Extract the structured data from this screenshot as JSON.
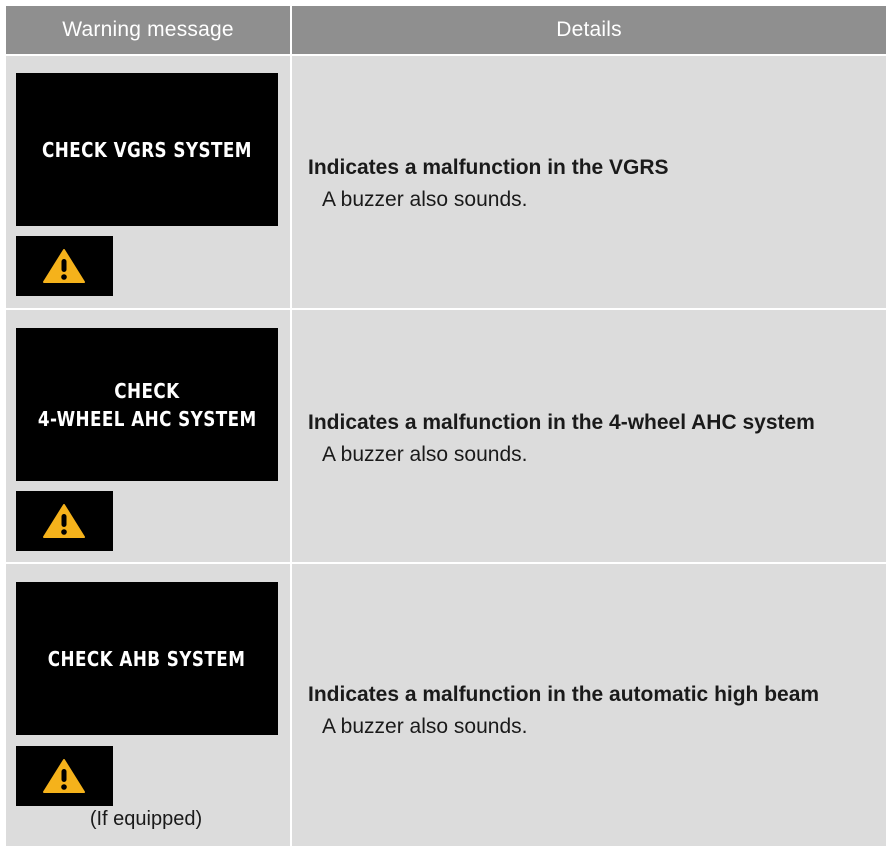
{
  "header": {
    "col_warning": "Warning message",
    "col_details": "Details"
  },
  "rows": [
    {
      "screen_lines": [
        "CHECK VGRS SYSTEM"
      ],
      "warning_icon": "warning-triangle-icon",
      "title": "Indicates a malfunction in the VGRS",
      "note": "A buzzer also sounds."
    },
    {
      "screen_lines": [
        "CHECK",
        "4-WHEEL AHC SYSTEM"
      ],
      "warning_icon": "warning-triangle-icon",
      "title": "Indicates a malfunction in the 4-wheel AHC system",
      "note": "A buzzer also sounds."
    },
    {
      "screen_lines": [
        "CHECK AHB SYSTEM"
      ],
      "warning_icon": "warning-triangle-icon",
      "equipped": "(If equipped)",
      "title": "Indicates a malfunction in the automatic high beam",
      "note": "A buzzer also sounds."
    }
  ],
  "colors": {
    "header_bg": "#8f8f8f",
    "cell_bg": "#dcdcdc",
    "warning_yellow": "#f5b21b"
  }
}
